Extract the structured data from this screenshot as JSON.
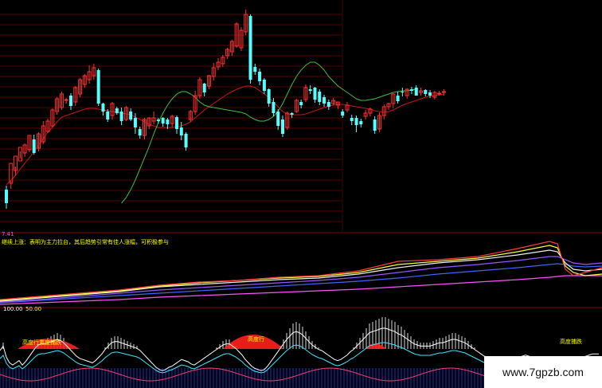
{
  "labels": {
    "ma": "7.41",
    "condition": "继续上涨：表明为主力拉台，其后趋势引常有佳人涨幅，可积极参与",
    "condition2": "",
    "value1": "100.00",
    "value2": "50.00",
    "tag1": "高度行重度捕跌",
    "tag2": "高度行",
    "tag3": "高度捕跌"
  },
  "watermark": "www.7gpzb.com",
  "colors": {
    "background": "#000000",
    "up": "#ff3030",
    "down": "#55ffff",
    "ma_long": "#c81414",
    "ma_short": "#3cbe3c",
    "grid": "#5a0000",
    "separator": "#8a0000",
    "line_white": "#f0f0f0",
    "line_yellow": "#ffff3c",
    "line_red": "#ff3c3c",
    "line_purple": "#9b55ff",
    "line_blue": "#3c64ff",
    "line_magenta": "#ff50ff"
  },
  "chart_data": [
    {
      "type": "candlestick",
      "title": "",
      "xlabel": "",
      "ylabel": "",
      "x": [
        0,
        1,
        2,
        3,
        4,
        5,
        6,
        7,
        8,
        9,
        10,
        11,
        12,
        13,
        14,
        15,
        16,
        17,
        18,
        19,
        20,
        21,
        22,
        23,
        24,
        25,
        26,
        27,
        28,
        29,
        30,
        31,
        32,
        33,
        34,
        35,
        36,
        37,
        38,
        39,
        40,
        41,
        42,
        43,
        44,
        45,
        46,
        47,
        48,
        49,
        50,
        51,
        52,
        53,
        54,
        55,
        56,
        57,
        58,
        59,
        60,
        61,
        62,
        63,
        64,
        65,
        66,
        67,
        68,
        69,
        70,
        71,
        72,
        73,
        74,
        75,
        76,
        77,
        78,
        79,
        80,
        81,
        82,
        83,
        84,
        85,
        86,
        87,
        88,
        89,
        90,
        91,
        92,
        93,
        94,
        95,
        96,
        97,
        98,
        99,
        100,
        101,
        102,
        103,
        104,
        105,
        106,
        107,
        108,
        109,
        110,
        111,
        112,
        113,
        114,
        115,
        116,
        117,
        118,
        119
      ],
      "open": [
        238,
        230,
        214,
        202,
        192,
        188,
        175,
        186,
        178,
        165,
        158,
        140,
        135,
        126,
        120,
        128,
        118,
        106,
        100,
        95,
        88,
        130,
        140,
        145,
        136,
        140,
        150,
        140,
        148,
        162,
        170,
        158,
        152,
        150,
        148,
        150,
        155,
        147,
        160,
        168,
        150,
        140,
        120,
        105,
        108,
        96,
        84,
        80,
        70,
        65,
        58,
        60,
        40,
        20,
        84,
        90,
        100,
        112,
        128,
        140,
        150,
        160,
        142,
        140,
        128,
        125,
        112,
        110,
        115,
        122,
        128,
        130,
        132,
        140,
        138,
        148,
        148,
        152,
        146,
        142,
        150,
        162,
        145,
        134,
        130,
        120,
        115,
        120,
        112,
        110,
        116,
        113,
        116,
        122,
        118,
        116
      ],
      "close": [
        255,
        205,
        196,
        185,
        182,
        170,
        192,
        168,
        158,
        152,
        138,
        124,
        118,
        125,
        133,
        110,
        100,
        95,
        90,
        85,
        130,
        140,
        150,
        130,
        142,
        152,
        135,
        150,
        160,
        170,
        150,
        148,
        148,
        152,
        155,
        156,
        146,
        162,
        170,
        185,
        140,
        120,
        100,
        116,
        95,
        85,
        78,
        72,
        62,
        52,
        30,
        38,
        18,
        100,
        90,
        102,
        114,
        130,
        142,
        158,
        168,
        142,
        144,
        126,
        132,
        110,
        114,
        125,
        128,
        130,
        134,
        126,
        128,
        145,
        132,
        152,
        157,
        156,
        142,
        137,
        164,
        145,
        134,
        130,
        118,
        127,
        115,
        112,
        114,
        120,
        114,
        118,
        120,
        116,
        117,
        115
      ],
      "high": [
        233,
        227,
        209,
        199,
        180,
        170,
        169,
        166,
        152,
        149,
        136,
        122,
        115,
        123,
        117,
        108,
        98,
        93,
        82,
        80,
        86,
        129,
        137,
        128,
        134,
        135,
        133,
        136,
        142,
        159,
        148,
        147,
        140,
        148,
        147,
        148,
        144,
        145,
        153,
        166,
        138,
        114,
        97,
        104,
        94,
        79,
        73,
        69,
        60,
        50,
        28,
        34,
        12,
        18,
        80,
        86,
        98,
        111,
        123,
        137,
        145,
        140,
        141,
        124,
        125,
        106,
        107,
        109,
        112,
        119,
        125,
        123,
        128,
        137,
        128,
        144,
        145,
        149,
        138,
        135,
        146,
        141,
        131,
        129,
        117,
        115,
        110,
        111,
        109,
        107,
        110,
        112,
        113,
        114,
        114,
        112
      ],
      "low": [
        262,
        237,
        220,
        190,
        197,
        191,
        194,
        190,
        181,
        167,
        160,
        144,
        138,
        130,
        138,
        133,
        122,
        110,
        105,
        100,
        133,
        145,
        153,
        150,
        144,
        157,
        152,
        152,
        168,
        174,
        175,
        162,
        156,
        155,
        159,
        162,
        160,
        168,
        176,
        189,
        153,
        144,
        124,
        121,
        112,
        101,
        88,
        84,
        74,
        70,
        60,
        64,
        44,
        105,
        94,
        107,
        118,
        134,
        146,
        163,
        172,
        163,
        148,
        142,
        136,
        128,
        118,
        129,
        132,
        134,
        138,
        132,
        137,
        148,
        141,
        157,
        166,
        160,
        150,
        146,
        168,
        166,
        150,
        138,
        136,
        130,
        121,
        124,
        118,
        115,
        120,
        121,
        123,
        125,
        120,
        120
      ],
      "ma_long": [
        232,
        226,
        220,
        212,
        205,
        198,
        190,
        182,
        174,
        166,
        160,
        153,
        147,
        145,
        143,
        141,
        139,
        137,
        136,
        136,
        137,
        138,
        139,
        140,
        141,
        142,
        143,
        144,
        147,
        150,
        153,
        156,
        158,
        160,
        160,
        160,
        160,
        159,
        158,
        156,
        153,
        148,
        143,
        138,
        134,
        130,
        126,
        122,
        118,
        115,
        112,
        110,
        108,
        108,
        110,
        114,
        118,
        122,
        128,
        134,
        140,
        143,
        144,
        144,
        144,
        143,
        141,
        139,
        137,
        135,
        133,
        132,
        131,
        131,
        132,
        133,
        134,
        135,
        136,
        137,
        139,
        140,
        141,
        140,
        138,
        135,
        132,
        130,
        128,
        126,
        124,
        122,
        121,
        120,
        119,
        118
      ],
      "ma_short": [
        255,
        248,
        238,
        226,
        212,
        198,
        184,
        168,
        154,
        142,
        132,
        124,
        118,
        115,
        115,
        118,
        122,
        128,
        132,
        134,
        135,
        136,
        137,
        138,
        139,
        140,
        141,
        143,
        147,
        150,
        152,
        152,
        150,
        146,
        140,
        130,
        118,
        106,
        96,
        88,
        82,
        78,
        78,
        82,
        88,
        96,
        102,
        108,
        112,
        116,
        120,
        124,
        126,
        126,
        125,
        124,
        122,
        120,
        118,
        116,
        115,
        114,
        114,
        113,
        112
      ],
      "ylim": [
        0,
        290
      ]
    },
    {
      "type": "line",
      "title": "",
      "xlabel": "",
      "ylabel": "",
      "x": [
        0,
        50,
        100,
        150,
        200,
        250,
        300,
        350,
        400,
        450,
        500,
        550,
        600,
        650,
        690,
        700,
        710,
        720,
        735,
        756
      ],
      "series": [
        {
          "key": "red",
          "values": [
            376,
            372,
            368,
            364,
            358,
            354,
            352,
            348,
            346,
            340,
            328,
            326,
            322,
            312,
            303,
            306,
            338,
            346,
            342,
            336
          ]
        },
        {
          "key": "yellow",
          "values": [
            377,
            373,
            369,
            365,
            359,
            355,
            352,
            349,
            347,
            342,
            332,
            328,
            324,
            316,
            308,
            311,
            334,
            342,
            346,
            344
          ]
        },
        {
          "key": "white",
          "values": [
            378,
            374,
            370,
            366,
            360,
            357,
            354,
            351,
            349,
            344,
            336,
            330,
            326,
            320,
            314,
            316,
            330,
            338,
            340,
            338
          ]
        },
        {
          "key": "purple",
          "values": [
            379,
            376,
            372,
            368,
            364,
            361,
            358,
            355,
            352,
            348,
            342,
            336,
            332,
            327,
            322,
            322,
            326,
            330,
            332,
            330
          ]
        },
        {
          "key": "blue",
          "values": [
            380,
            377,
            374,
            371,
            368,
            365,
            362,
            359,
            356,
            353,
            349,
            344,
            340,
            336,
            332,
            331,
            332,
            334,
            335,
            334
          ]
        },
        {
          "key": "magenta",
          "values": [
            382,
            380,
            378,
            376,
            373,
            371,
            369,
            367,
            365,
            363,
            360,
            357,
            354,
            351,
            348,
            347,
            346,
            346,
            346,
            346
          ]
        }
      ],
      "ylim": [
        290,
        390
      ]
    },
    {
      "type": "bar",
      "title": "",
      "xlabel": "",
      "ylabel": "",
      "baseline": 438,
      "x": [
        0,
        4,
        8,
        12,
        16,
        20,
        24,
        28,
        32,
        36,
        40,
        44,
        48,
        52,
        56,
        60,
        64,
        68,
        72,
        76,
        80,
        84,
        88,
        92,
        96,
        100,
        104,
        108,
        112,
        116,
        120,
        124,
        128,
        132,
        136,
        140,
        144,
        148,
        152,
        156,
        160,
        164,
        168,
        172,
        176,
        180,
        184,
        188,
        192,
        196,
        200,
        204,
        208,
        212,
        216,
        220,
        224,
        228,
        232,
        236,
        240,
        244,
        248,
        252,
        256,
        260,
        264,
        268,
        272,
        276,
        280,
        284,
        288,
        292,
        296,
        300,
        304,
        308,
        312,
        316,
        320,
        324,
        328,
        332,
        336,
        340,
        344,
        348,
        352,
        356,
        360,
        364,
        368,
        372,
        376,
        380,
        384,
        388,
        392,
        396,
        400,
        404,
        408,
        412,
        416,
        420,
        424,
        428,
        432,
        436,
        440,
        444,
        448,
        452,
        456,
        460,
        464,
        468,
        472,
        476,
        480,
        484,
        488,
        492,
        496,
        500,
        504,
        508,
        512,
        516,
        520,
        524,
        528,
        532,
        536,
        540,
        544,
        548,
        552,
        556,
        560,
        564,
        568,
        572,
        576,
        580,
        584,
        588,
        592,
        596,
        600,
        604,
        608,
        612,
        616,
        620,
        624,
        628,
        632,
        636,
        640,
        644,
        648,
        652,
        656,
        660,
        664,
        668,
        672,
        676,
        680,
        684,
        688,
        692,
        696,
        700,
        704,
        708,
        712,
        716,
        720,
        724,
        728,
        732,
        736,
        740,
        744,
        748,
        752
      ],
      "values": [
        0,
        8,
        -12,
        -22,
        -26,
        -22,
        -18,
        -26,
        -20,
        -12,
        -4,
        4,
        10,
        12,
        12,
        14,
        16,
        18,
        20,
        18,
        14,
        8,
        2,
        -4,
        -10,
        -14,
        -16,
        -18,
        -20,
        -22,
        -18,
        -12,
        -6,
        2,
        8,
        14,
        16,
        16,
        14,
        12,
        10,
        8,
        6,
        4,
        0,
        -6,
        -12,
        -18,
        -24,
        -30,
        -34,
        -36,
        -34,
        -30,
        -28,
        -24,
        -20,
        -16,
        -18,
        -20,
        -24,
        -26,
        -22,
        -18,
        -14,
        -10,
        -6,
        -2,
        2,
        6,
        10,
        12,
        12,
        8,
        4,
        -2,
        -8,
        -16,
        -22,
        -28,
        -32,
        -34,
        -36,
        -34,
        -28,
        -20,
        -12,
        -4,
        4,
        12,
        20,
        26,
        32,
        34,
        32,
        28,
        22,
        16,
        10,
        6,
        2,
        0,
        -4,
        -8,
        -12,
        -16,
        -18,
        -16,
        -12,
        -8,
        -2,
        2,
        8,
        14,
        20,
        26,
        32,
        34,
        36,
        38,
        40,
        40,
        38,
        36,
        34,
        30,
        28,
        24,
        20,
        16,
        12,
        10,
        8,
        8,
        8,
        8,
        10,
        12,
        14,
        14,
        16,
        18,
        20,
        20,
        18,
        16,
        14,
        10,
        6,
        2,
        -2,
        -6,
        -10,
        -12,
        -12,
        -12,
        -14,
        -14,
        -14,
        -16,
        -14,
        -14,
        -12,
        -12,
        -10,
        -8,
        -10,
        -12,
        -14,
        -18,
        -20,
        -22,
        -22,
        -24,
        -24,
        -24,
        -22,
        -22,
        -20,
        -18,
        -16,
        -14,
        -14,
        -12,
        -10,
        -8,
        -6,
        -6,
        -6,
        -4,
        -4,
        -4,
        -4,
        -4
      ],
      "ylim": [
        380,
        487
      ]
    }
  ]
}
